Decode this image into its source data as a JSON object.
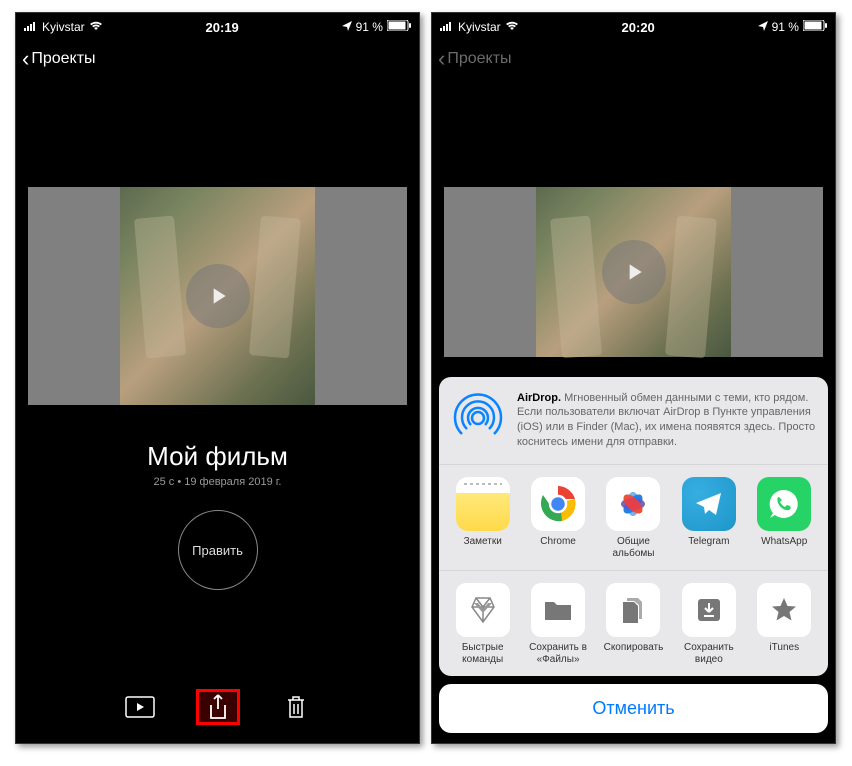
{
  "left": {
    "status": {
      "carrier": "Kyivstar",
      "time": "20:19",
      "battery": "91 %"
    },
    "nav": {
      "back": "Проекты"
    },
    "movie": {
      "title": "Мой фильм",
      "meta": "25 с • 19 февраля 2019 г.",
      "edit": "Править"
    }
  },
  "right": {
    "status": {
      "carrier": "Kyivstar",
      "time": "20:20",
      "battery": "91 %"
    },
    "nav": {
      "back": "Проекты"
    },
    "airdrop": {
      "title": "AirDrop.",
      "body": "Мгновенный обмен данными с теми, кто рядом. Если пользователи включат AirDrop в Пункте управления (iOS) или в Finder (Mac), их имена появятся здесь. Просто коснитесь имени для отправки."
    },
    "apps": [
      {
        "label": "Заметки"
      },
      {
        "label": "Chrome"
      },
      {
        "label": "Общие альбомы"
      },
      {
        "label": "Telegram"
      },
      {
        "label": "WhatsApp"
      }
    ],
    "actions": [
      {
        "label": "Быстрые команды"
      },
      {
        "label": "Сохранить в «Файлы»"
      },
      {
        "label": "Скопировать"
      },
      {
        "label": "Сохранить видео"
      },
      {
        "label": "iTunes"
      }
    ],
    "cancel": "Отменить"
  }
}
